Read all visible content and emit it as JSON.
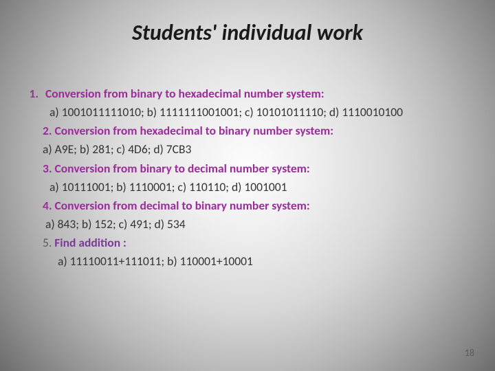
{
  "title": "Students' individual work",
  "items": [
    {
      "num": "1.",
      "heading": "Conversion from binary to hexadecimal number system:",
      "body": "a) 1001011111010;  b) 1111111001001; c) 10101011110; d) 1110010100"
    },
    {
      "num": "2.",
      "heading": "Conversion from hexadecimal to binary number system:",
      "body": "a) A9E; b) 281; c) 4D6; d) 7CB3"
    },
    {
      "num": "3.",
      "heading": "Conversion from binary to decimal number system:",
      "body": "a) 10111001; b) 1110001; c) 110110; d) 1001001"
    },
    {
      "num": "4.",
      "heading": "Conversion from decimal to binary number system:",
      "body": "a) 843; b) 152; c) 491; d) 534"
    },
    {
      "num": "5.",
      "heading": "Find addition :",
      "body": "a) 11110011+111011; b) 110001+10001"
    }
  ],
  "page_number": "18"
}
